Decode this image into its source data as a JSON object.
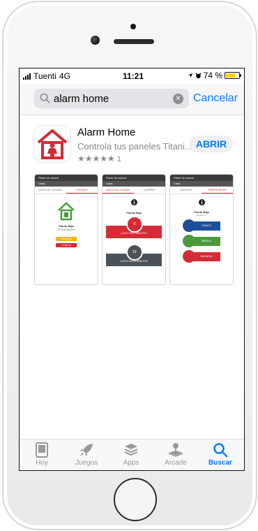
{
  "status": {
    "carrier": "Tuenti",
    "network": "4G",
    "time": "11:21",
    "battery": "74 %",
    "battery_level": 0.74
  },
  "search": {
    "query": "alarm home",
    "cancel_label": "Cancelar"
  },
  "app": {
    "name": "Alarm Home",
    "subtitle": "Controla tus paneles Titani...",
    "stars": "★★★★★",
    "rating_count": "1",
    "open_label": "ABRIR"
  },
  "screenshots": [
    {
      "title": "Panel de control",
      "subtitle": "Casa",
      "tabs": [
        "MODO DE LLEGADA",
        "CONTROL"
      ],
      "zone": "Planta Baja",
      "state": "DESARMADO",
      "button1": "PRESENTE",
      "button2": "AUSENTE"
    },
    {
      "title": "Panel de control",
      "subtitle": "Casa",
      "tabs": [
        "MODO DE LLEGADA",
        "CONTROL"
      ],
      "zone": "Planta Baja",
      "timer1": "5'",
      "row1": "LLEGO EN 5 MINUTOS",
      "timer2": "10'",
      "row2": "LLEGO EN 10 MINUTOS"
    },
    {
      "title": "Panel de control",
      "subtitle": "Casa",
      "tabs": [
        "EVENTOS",
        "EMERGENCIAS"
      ],
      "zone": "Planta Baja",
      "zone_sub": "Partición 1",
      "e1": "PÁNICO",
      "e2": "MÉDICA",
      "e3": "INCENDIO"
    }
  ],
  "tabbar": [
    {
      "label": "Hoy",
      "icon": "today-icon"
    },
    {
      "label": "Juegos",
      "icon": "rocket-icon"
    },
    {
      "label": "Apps",
      "icon": "apps-stack-icon"
    },
    {
      "label": "Arcade",
      "icon": "joystick-icon"
    },
    {
      "label": "Buscar",
      "icon": "search-icon"
    }
  ],
  "colors": {
    "accent": "#0a7aff",
    "brand_red": "#d42b35",
    "brand_green": "#4a9a3c",
    "brand_blue": "#1f4f9a"
  }
}
